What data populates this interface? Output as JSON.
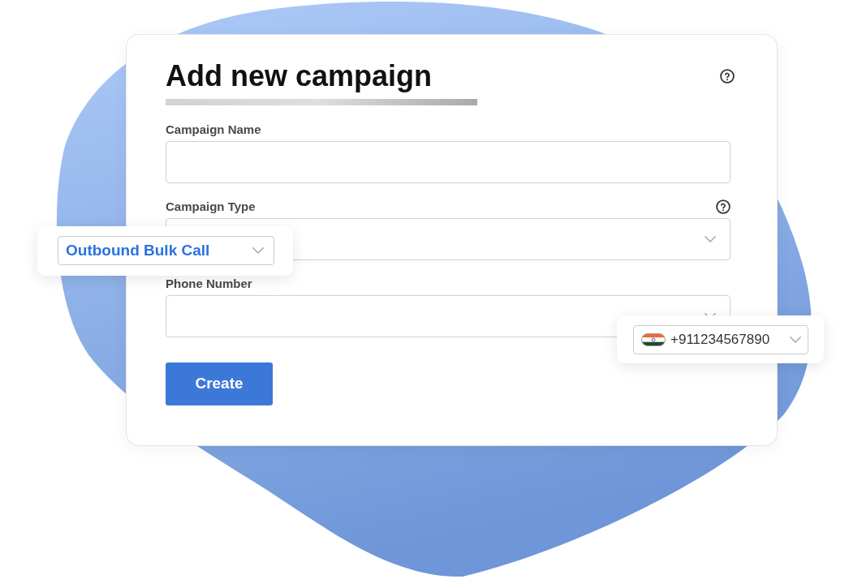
{
  "title": "Add new campaign",
  "fields": [
    {
      "kind": "text",
      "label": "Campaign Name",
      "help": false
    },
    {
      "kind": "select",
      "label": "Campaign Type",
      "help": true
    },
    {
      "kind": "select",
      "label": "Phone Number",
      "help": false
    }
  ],
  "button": "Create",
  "popouts": [
    {
      "kind": "select",
      "value": "Outbound Bulk Call"
    },
    {
      "kind": "phone",
      "value": "+911234567890"
    }
  ]
}
